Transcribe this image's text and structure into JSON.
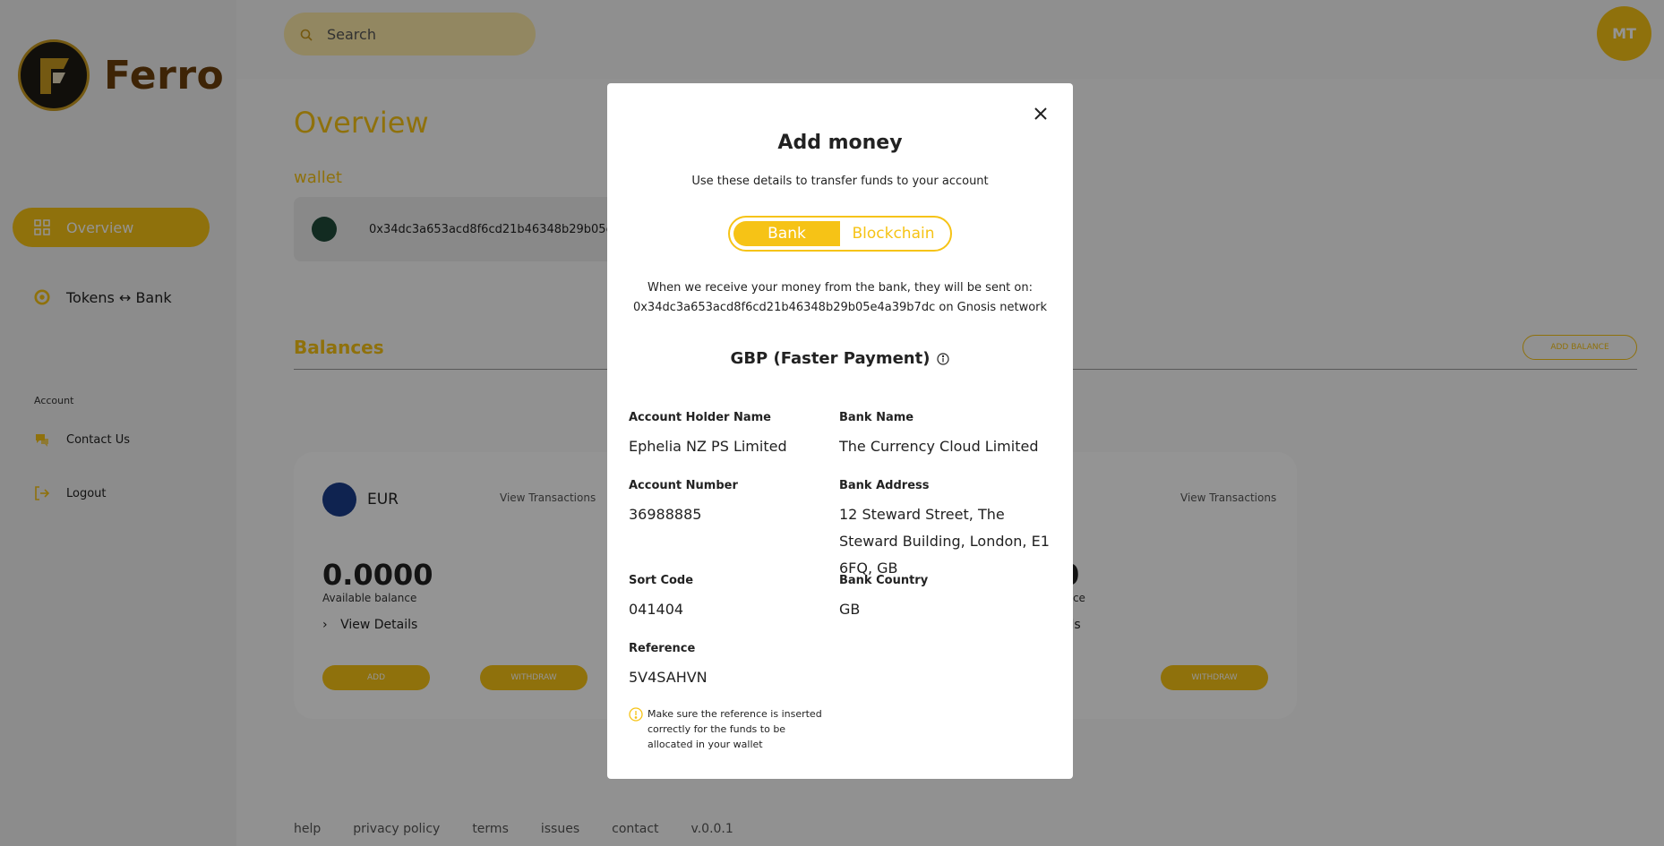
{
  "app": {
    "name": "Ferro"
  },
  "sidebar": {
    "items": [
      {
        "label": "Overview",
        "icon": "grid-icon"
      },
      {
        "label": "Tokens ↔ Bank",
        "icon": "coins-icon"
      }
    ],
    "section_label": "Account",
    "account_items": [
      {
        "label": "Contact Us",
        "icon": "chat-icon"
      },
      {
        "label": "Logout",
        "icon": "logout-icon"
      }
    ]
  },
  "topbar": {
    "search_placeholder": "Search",
    "avatar_initials": "MT"
  },
  "main": {
    "title": "Overview",
    "wallet_label": "wallet",
    "wallet_address": "0x34dc3a653acd8f6cd21b46348b29b05e4a39b7dc",
    "balances_title": "Balances",
    "add_balance_label": "ADD BALANCE",
    "cards": [
      {
        "currency": "EUR",
        "view_transactions": "View Transactions",
        "amount": "0.0000",
        "available_label": "Available balance",
        "view_details": "View Details",
        "add_label": "ADD",
        "withdraw_label": "WITHDRAW"
      },
      {
        "view_transactions": "View Transactions",
        "amount_partial": "0",
        "available_partial": "ance",
        "details_partial": "ails",
        "withdraw_label": "WITHDRAW"
      }
    ]
  },
  "footer": {
    "links": [
      "help",
      "privacy policy",
      "terms",
      "issues",
      "contact",
      "v.0.0.1"
    ]
  },
  "modal": {
    "title": "Add money",
    "subtitle": "Use these details to transfer funds to your account",
    "toggle": {
      "bank": "Bank",
      "blockchain": "Blockchain",
      "selected": "Bank"
    },
    "info_line1": "When we receive your money from the bank, they will be sent on:",
    "info_line2": "0x34dc3a653acd8f6cd21b46348b29b05e4a39b7dc on Gnosis network",
    "section_title": "GBP (Faster Payment)",
    "fields": {
      "account_holder_label": "Account Holder Name",
      "account_holder_value": "Ephelia NZ PS Limited",
      "bank_name_label": "Bank Name",
      "bank_name_value": "The Currency Cloud Limited",
      "account_number_label": "Account Number",
      "account_number_value": "36988885",
      "bank_address_label": "Bank Address",
      "bank_address_value": "12 Steward Street, The Steward Building, London, E1 6FQ, GB",
      "sort_code_label": "Sort Code",
      "sort_code_value": "041404",
      "bank_country_label": "Bank Country",
      "bank_country_value": "GB",
      "reference_label": "Reference",
      "reference_value": "5V4SAHVN"
    },
    "warning": "Make sure the reference is inserted correctly for the funds to be allocated in your wallet"
  },
  "colors": {
    "accent": "#f6c316",
    "brand_text": "#6b3e0c",
    "overlay": "rgba(0,0,0,0.42)"
  }
}
